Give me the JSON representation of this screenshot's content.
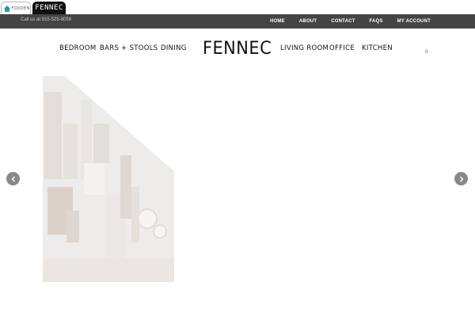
{
  "brand_tabs": {
    "foxden_label": "FOXDEN",
    "fennec_label": "FENNEC"
  },
  "top_bar": {
    "call_text": "Call us at 915-525-8059",
    "nav": [
      "HOME",
      "ABOUT",
      "CONTACT",
      "FAQS",
      "MY ACCOUNT"
    ]
  },
  "main_nav": {
    "left": [
      "BEDROOM",
      "BARS + STOOLS",
      "DINING"
    ],
    "logo": "FENNEC",
    "right": [
      "LIVING ROOM",
      "OFFICE",
      "KITCHEN"
    ],
    "cart_count": "0"
  },
  "colors": {
    "top_bar_bg": "#444444",
    "arrow_bg": "#888888",
    "foxden_accent": "#2a9d8f"
  },
  "icons": {
    "slider_prev": "chevron-left-icon",
    "slider_next": "chevron-right-icon",
    "foxden": "house-icon"
  }
}
